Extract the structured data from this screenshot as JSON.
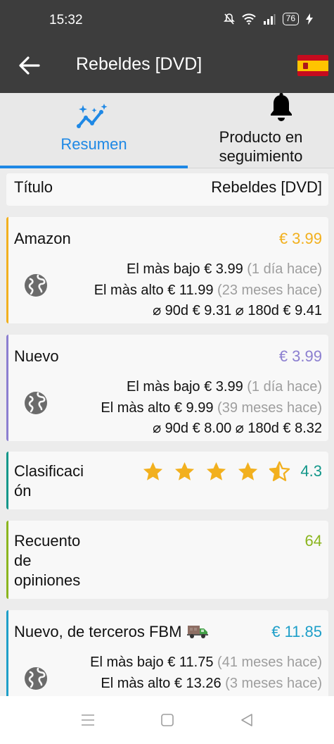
{
  "status": {
    "time": "15:32",
    "battery": "76"
  },
  "appbar": {
    "title": "Rebeldes [DVD]"
  },
  "tabs": [
    {
      "label": "Resumen",
      "active": true,
      "icon": "trend-sparkle-icon"
    },
    {
      "label": "Producto en seguimiento",
      "active": false,
      "icon": "bell-icon"
    }
  ],
  "title_card": {
    "label": "Título",
    "value": "Rebeldes [DVD]"
  },
  "amazon": {
    "label": "Amazon",
    "price": "€ 3.99",
    "accent": "#f2b01e",
    "low_label": "El màs bajo",
    "low_value": "€ 3.99",
    "low_time": "(1 día hace)",
    "high_label": "El màs alto",
    "high_value": "€ 11.99",
    "high_time": "(23 meses hace)",
    "avg": "⌀ 90d € 9.31 ⌀ 180d € 9.41"
  },
  "new": {
    "label": "Nuevo",
    "price": "€ 3.99",
    "accent": "#8c7fd0",
    "low_label": "El màs bajo",
    "low_value": "€ 3.99",
    "low_time": "(1 día hace)",
    "high_label": "El màs alto",
    "high_value": "€ 9.99",
    "high_time": "(39 meses hace)",
    "avg": "⌀ 90d € 8.00 ⌀ 180d € 8.32"
  },
  "rating": {
    "label": "Clasificaci ón",
    "label_line1": "Clasificaci",
    "label_line2": "ón",
    "value": "4.3",
    "stars": 4.3,
    "accent": "#13978a"
  },
  "reviews": {
    "label_lines": [
      "Recuento",
      "de",
      "opiniones"
    ],
    "value": "64",
    "accent": "#8bb51e"
  },
  "fbm": {
    "label": "Nuevo, de terceros FBM",
    "price": "€ 11.85",
    "accent": "#1e9fc9",
    "low_label": "El màs bajo",
    "low_value": "€ 11.75",
    "low_time": "(41 meses hace)",
    "high_label": "El màs alto",
    "high_value": "€ 13.26",
    "high_time": "(3 meses hace)"
  }
}
